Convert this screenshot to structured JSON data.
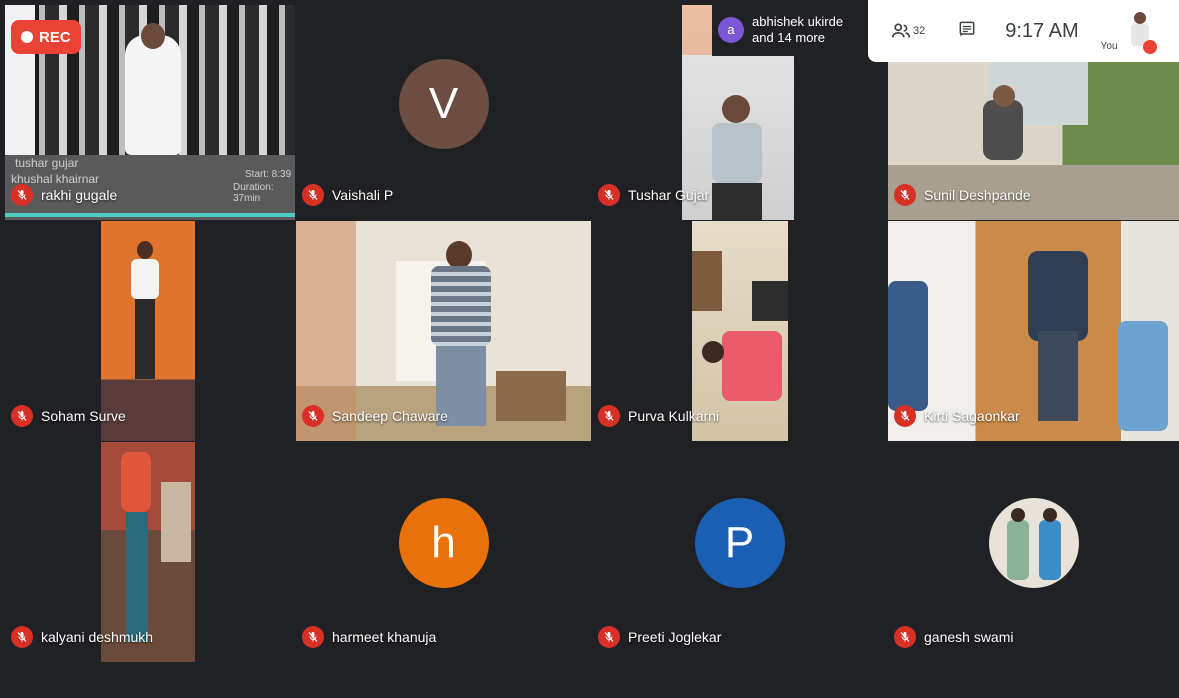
{
  "recording": {
    "label": "REC"
  },
  "raised_hands": {
    "avatar_letter": "a",
    "line1": "abhishek ukirde",
    "line2": "and 14 more"
  },
  "topbar": {
    "people_count": "32",
    "time": "9:17 AM",
    "self_label": "You"
  },
  "overlay": {
    "lines": [
      "tushar gujar",
      "khushal khairnar"
    ],
    "start": "Start: 8:39",
    "duration": "Duration: 37min"
  },
  "participants": [
    {
      "name": "rakhi gugale"
    },
    {
      "name": "Vaishali P",
      "avatar_letter": "V",
      "avatar_color": "#6d4c41"
    },
    {
      "name": "Tushar Gujar"
    },
    {
      "name": "Sunil Deshpande"
    },
    {
      "name": "Soham Surve"
    },
    {
      "name": "Sandeep Chaware"
    },
    {
      "name": "Purva Kulkarni"
    },
    {
      "name": "Kirti Sagaonkar"
    },
    {
      "name": "kalyani deshmukh"
    },
    {
      "name": "harmeet khanuja",
      "avatar_letter": "h",
      "avatar_color": "#e8710a"
    },
    {
      "name": "Preeti Joglekar",
      "avatar_letter": "P",
      "avatar_color": "#1a5fb4"
    },
    {
      "name": "ganesh swami"
    }
  ],
  "colors": {
    "background": "#202124",
    "mic_off": "#d93025",
    "rec": "#ea4335"
  }
}
